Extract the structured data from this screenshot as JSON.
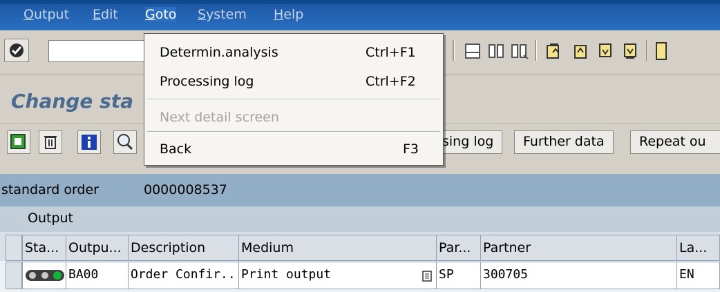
{
  "menubar": {
    "items": [
      "Output",
      "Edit",
      "Goto",
      "System",
      "Help"
    ]
  },
  "title": "Change sta",
  "app_toolbar": {
    "buttons": [
      "sing log",
      "Further data",
      "Repeat ou"
    ]
  },
  "header": {
    "doc_type": "standard order",
    "doc_number": "0000008537"
  },
  "table": {
    "title": "Output",
    "columns": [
      "Sta...",
      "Outpu...",
      "Description",
      "Medium",
      "Par...",
      "Partner",
      "La..."
    ],
    "rows": [
      {
        "output": "BA00",
        "description": "Order Confir...",
        "medium": "Print output",
        "par": "SP",
        "partner": "300705",
        "lang": "EN"
      }
    ]
  },
  "goto_menu": {
    "items": [
      {
        "label": "Determin.analysis",
        "accel": "Ctrl+F1",
        "enabled": true
      },
      {
        "label": "Processing log",
        "accel": "Ctrl+F2",
        "enabled": true
      },
      {
        "label": "Next detail screen",
        "accel": "",
        "enabled": false
      },
      {
        "label": "Back",
        "accel": "F3",
        "enabled": true
      }
    ]
  },
  "colors": {
    "menubar": "#1d59a6",
    "title": "#4b6a90",
    "header_band": "#93aec7",
    "status_green": "#11b33c"
  },
  "icons": [
    "ok-check-icon",
    "print-icon",
    "find-icon",
    "find-next-icon",
    "first-page-icon",
    "previous-page-icon",
    "next-page-icon",
    "last-page-icon",
    "create-session-icon",
    "details-icon",
    "delete-icon",
    "info-icon",
    "search-icon",
    "traffic-light-icon",
    "document-icon"
  ]
}
